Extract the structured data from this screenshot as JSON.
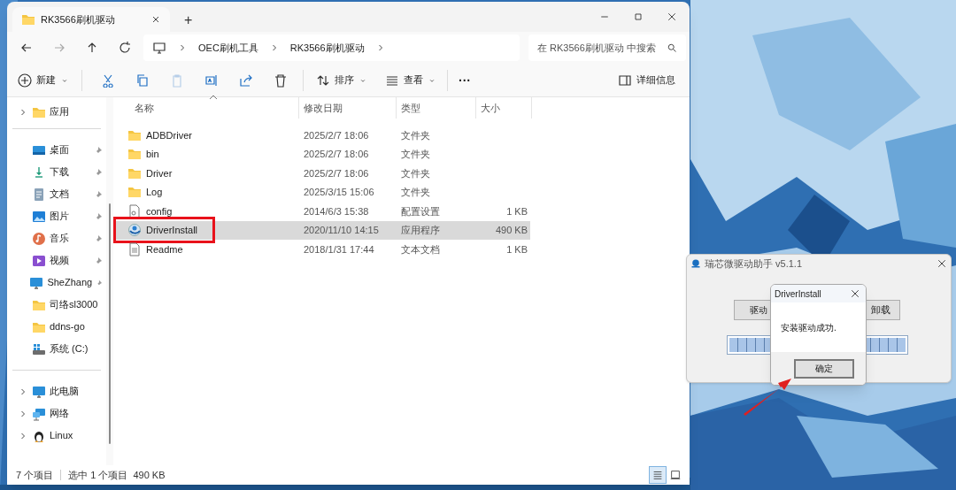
{
  "explorer": {
    "tabs": [
      {
        "label": "RK3566刷机驱动",
        "selected": true
      }
    ],
    "new_tab": "+",
    "breadcrumb": [
      "OEC刷机工具",
      "RK3566刷机驱动"
    ],
    "search": {
      "placeholder": "在 RK3566刷机驱动 中搜索"
    },
    "toolbar": [
      {
        "kind": "new",
        "label": "新建"
      },
      {
        "kind": "cut",
        "disabled": false
      },
      {
        "kind": "copy",
        "disabled": false
      },
      {
        "kind": "paste",
        "disabled": true
      },
      {
        "kind": "rename",
        "disabled": false
      },
      {
        "kind": "share",
        "disabled": false
      },
      {
        "kind": "delete",
        "disabled": false
      },
      {
        "kind": "sort",
        "label": "排序"
      },
      {
        "kind": "view",
        "label": "查看"
      },
      {
        "kind": "more",
        "label": "···"
      }
    ],
    "details_button": "详细信息",
    "sidebar": [
      [
        {
          "label": "应用",
          "kind": "folder",
          "expandable": true
        }
      ],
      [
        {
          "label": "桌面",
          "kind": "desktop",
          "pinned": true
        },
        {
          "label": "下载",
          "kind": "download",
          "pinned": true
        },
        {
          "label": "文档",
          "kind": "document",
          "pinned": true
        },
        {
          "label": "图片",
          "kind": "pictures",
          "pinned": true
        },
        {
          "label": "音乐",
          "kind": "music",
          "pinned": true
        },
        {
          "label": "视频",
          "kind": "video",
          "pinned": true
        },
        {
          "label": "SheZhang",
          "kind": "monitor",
          "pinned": true
        },
        {
          "label": "司络sl3000",
          "kind": "folder",
          "pinned": false
        },
        {
          "label": "ddns-go",
          "kind": "folder",
          "pinned": false
        },
        {
          "label": "系统 (C:)",
          "kind": "drive",
          "pinned": false
        }
      ],
      [
        {
          "label": "此电脑",
          "kind": "monitor",
          "expandable": true
        },
        {
          "label": "网络",
          "kind": "network",
          "expandable": true
        },
        {
          "label": "Linux",
          "kind": "penguin",
          "expandable": true
        }
      ]
    ],
    "columns": [
      "名称",
      "修改日期",
      "类型",
      "大小"
    ],
    "rows": [
      {
        "name": "ADBDriver",
        "kind": "folder",
        "date": "2025/2/7 18:06",
        "type": "文件夹",
        "selected": false,
        "highlighted": false
      },
      {
        "name": "bin",
        "kind": "folder",
        "date": "2025/2/7 18:06",
        "type": "文件夹",
        "selected": false,
        "highlighted": false
      },
      {
        "name": "Driver",
        "kind": "folder",
        "date": "2025/2/7 18:06",
        "type": "文件夹",
        "selected": false,
        "highlighted": false
      },
      {
        "name": "Log",
        "kind": "folder",
        "date": "2025/3/15 15:06",
        "type": "文件夹",
        "selected": false,
        "highlighted": false
      },
      {
        "name": "config",
        "kind": "settings-file",
        "date": "2014/6/3 15:38",
        "type": "配置设置",
        "size": "1 KB",
        "selected": false,
        "highlighted": false
      },
      {
        "name": "DriverInstall",
        "kind": "app",
        "date": "2020/11/10 14:15",
        "type": "应用程序",
        "size": "490 KB",
        "selected": true,
        "highlighted": true
      },
      {
        "name": "Readme",
        "kind": "text-file",
        "date": "2018/1/31 17:44",
        "type": "文本文档",
        "size": "1 KB",
        "selected": false,
        "highlighted": false
      }
    ],
    "status": [
      "7 个项目",
      "选中 1 个项目",
      "490 KB"
    ],
    "views": [
      {
        "kind": "details",
        "selected": true
      },
      {
        "kind": "tiles",
        "selected": false
      }
    ]
  },
  "app_window": {
    "title": "瑞芯微驱动助手 v5.1.1",
    "buttons": [
      "驱动",
      "卸载"
    ],
    "progress": {
      "level": 1
    }
  },
  "message_box": {
    "title": "DriverInstall",
    "message": "安装驱动成功.",
    "ok": "确定"
  }
}
